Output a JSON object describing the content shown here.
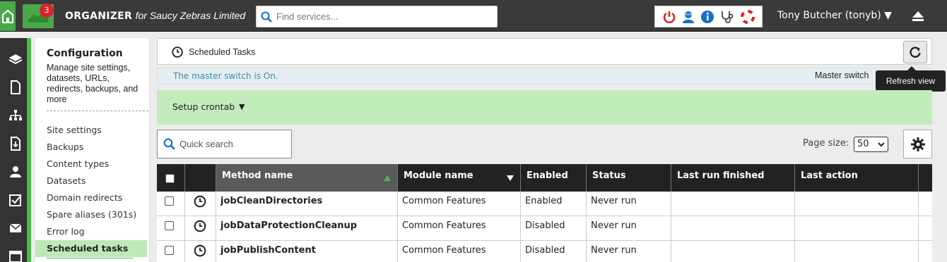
{
  "topbar": {
    "notification_count": "3",
    "brand_name": "ORGANIZER",
    "brand_suffix": "for Saucy Zebras Limited",
    "search_placeholder": "Find services...",
    "user_label": "Tony Butcher (tonyb) ▼",
    "tool_icons": [
      "power-icon",
      "support-agent-icon",
      "info-icon",
      "stethoscope-icon",
      "lifebuoy-icon"
    ]
  },
  "rail_icons": [
    "layers-icon",
    "document-icon",
    "sitemap-icon",
    "file-download-icon",
    "user-icon",
    "checkbox-icon",
    "envelope-icon",
    "calendar-icon"
  ],
  "sidenav": {
    "title": "Configuration",
    "description": "Manage site settings, datasets, URLs, redirects, backups, and more",
    "items": [
      {
        "label": "Site settings"
      },
      {
        "label": "Backups"
      },
      {
        "label": "Content types"
      },
      {
        "label": "Datasets"
      },
      {
        "label": "Domain redirects"
      },
      {
        "label": "Spare aliases (301s)"
      },
      {
        "label": "Error log"
      },
      {
        "label": "Scheduled tasks",
        "active": true
      }
    ]
  },
  "panel": {
    "title": "Scheduled Tasks",
    "refresh_tooltip": "Refresh view",
    "master_status": "The master switch is On.",
    "master_switch_label": "Master switch",
    "crontab_label": "Setup crontab",
    "crontab_arrow": "▼",
    "quick_search_placeholder": "Quick search",
    "page_size_label": "Page size:",
    "page_size_value": "50"
  },
  "table": {
    "columns": [
      "Method name",
      "Module name",
      "Enabled",
      "Status",
      "Last run finished",
      "Last action"
    ],
    "rows": [
      {
        "method": "jobCleanDirectories",
        "module": "Common Features",
        "enabled": "Enabled",
        "status": "Never run",
        "last_run": "",
        "last_action": ""
      },
      {
        "method": "jobDataProtectionCleanup",
        "module": "Common Features",
        "enabled": "Disabled",
        "status": "Never run",
        "last_run": "",
        "last_action": ""
      },
      {
        "method": "jobPublishContent",
        "module": "Common Features",
        "enabled": "Disabled",
        "status": "Never run",
        "last_run": "",
        "last_action": ""
      }
    ]
  },
  "colors": {
    "topbar": "#3a3a3a",
    "accent_green": "#4cb84c",
    "crontab_bg": "#c3ecbd",
    "badge_red": "#d9232a",
    "info_text": "#3a8cab"
  }
}
